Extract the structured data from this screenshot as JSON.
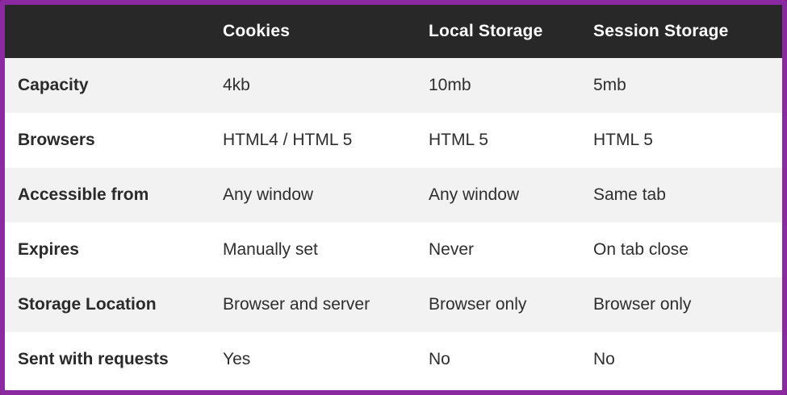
{
  "table": {
    "headers": [
      "",
      "Cookies",
      "Local Storage",
      "Session Storage"
    ],
    "rows": [
      {
        "label": "Capacity",
        "cells": [
          "4kb",
          "10mb",
          "5mb"
        ]
      },
      {
        "label": "Browsers",
        "cells": [
          "HTML4 / HTML 5",
          "HTML 5",
          "HTML 5"
        ]
      },
      {
        "label": "Accessible from",
        "cells": [
          "Any window",
          "Any window",
          "Same tab"
        ]
      },
      {
        "label": "Expires",
        "cells": [
          "Manually set",
          "Never",
          "On tab close"
        ]
      },
      {
        "label": "Storage Location",
        "cells": [
          "Browser and server",
          "Browser only",
          "Browser only"
        ]
      },
      {
        "label": "Sent with requests",
        "cells": [
          "Yes",
          "No",
          "No"
        ]
      }
    ]
  },
  "colors": {
    "frame": "#8b2aa0",
    "header_bg": "#282828",
    "header_text": "#ffffff",
    "row_alt_bg": "#f2f2f2"
  }
}
